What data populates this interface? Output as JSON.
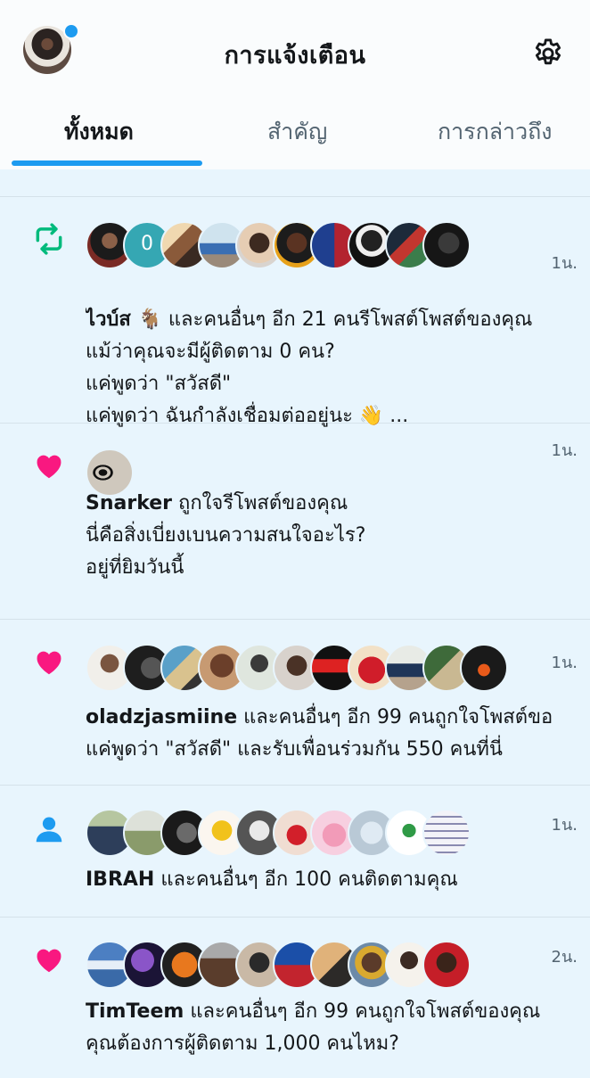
{
  "header": {
    "title": "การแจ้งเตือน",
    "tabs": [
      {
        "label": "ทั้งหมด"
      },
      {
        "label": "สำคัญ"
      },
      {
        "label": "การกล่าวถึง"
      }
    ]
  },
  "colors": {
    "accent": "#1d9bf0",
    "retweet": "#00ba7c",
    "like": "#f91880",
    "follow": "#1d9bf0",
    "background": "#e8f5fd"
  },
  "notifications": [
    {
      "type": "retweet",
      "icon": "retweet-icon",
      "time": "1น.",
      "avatar_count": 11,
      "name": "ไวบ์ส 🐐",
      "action": " และคนอื่นๆ อีก 21 คนรีโพสต์โพสต์ของคุณ",
      "lines": [
        "แม้ว่าคุณจะมีผู้ติดตาม 0 คน?",
        "แค่พูดว่า \"สวัสดี\"",
        "แค่พูดว่า ฉันกำลังเชื่อมต่ออยู่นะ 👋 ..."
      ],
      "zero_avatar_label": "0"
    },
    {
      "type": "like",
      "icon": "heart-icon",
      "time": "1น.",
      "avatar_count": 1,
      "name": "Snarker",
      "action": " ถูกใจรีโพสต์ของคุณ",
      "lines": [
        "นี่คือสิ่งเบี่ยงเบนความสนใจอะไร?",
        "อยู่ที่ยิมวันนี้"
      ]
    },
    {
      "type": "like",
      "icon": "heart-icon",
      "time": "1น.",
      "avatar_count": 11,
      "name": "oladzjasmiine",
      "action": " และคนอื่นๆ อีก 99 คนถูกใจโพสต์ขอ",
      "lines": [
        "แค่พูดว่า \"สวัสดี\" และรับเพื่อนร่วมกัน 550 คนที่นี่"
      ]
    },
    {
      "type": "follow",
      "icon": "person-icon",
      "time": "1น.",
      "avatar_count": 11,
      "name": "IBRAH",
      "action": " และคนอื่นๆ อีก 100 คนติดตามคุณ",
      "lines": []
    },
    {
      "type": "like",
      "icon": "heart-icon",
      "time": "2น.",
      "avatar_count": 11,
      "name": "TimTeem",
      "action": " และคนอื่นๆ อีก 99 คนถูกใจโพสต์ของคุณ",
      "lines": [
        "คุณต้องการผู้ติดตาม 1,000 คนไหม?"
      ]
    }
  ]
}
